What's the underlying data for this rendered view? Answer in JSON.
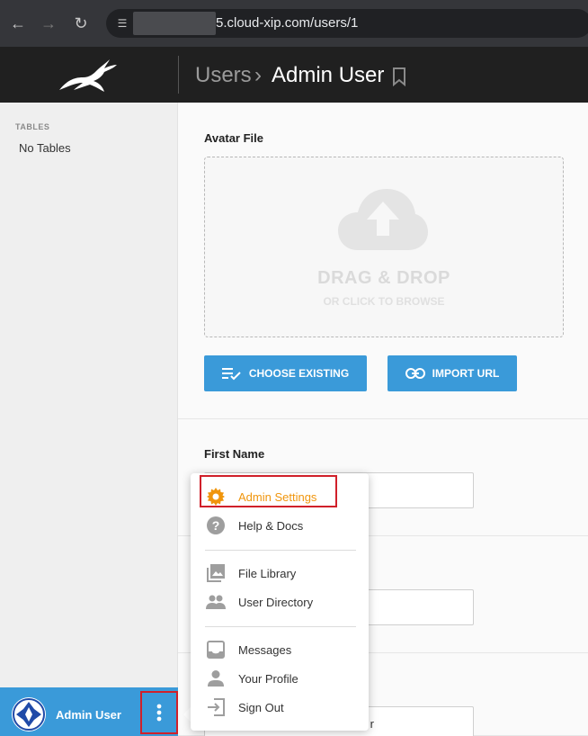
{
  "browser": {
    "back_icon": "back-arrow-icon",
    "forward_icon": "forward-arrow-icon",
    "reload_icon": "reload-icon",
    "url": "5.cloud-xip.com/users/1"
  },
  "header": {
    "breadcrumb_parent": "Users",
    "breadcrumb_separator": "›",
    "breadcrumb_current": "Admin User",
    "bookmark_icon": "bookmark-icon"
  },
  "sidebar": {
    "tables_heading": "TABLES",
    "no_tables": "No Tables"
  },
  "form": {
    "avatar_label": "Avatar File",
    "dropzone_main": "DRAG & DROP",
    "dropzone_sub": "OR CLICK TO BROWSE",
    "choose_existing": "CHOOSE EXISTING",
    "import_url": "IMPORT URL",
    "first_name_label": "First Name",
    "last_field_value_partial": "r"
  },
  "user_bar": {
    "name": "Admin User"
  },
  "menu": {
    "items": [
      {
        "label": "Admin Settings",
        "icon": "gear-icon",
        "active": true
      },
      {
        "label": "Help & Docs",
        "icon": "help-icon"
      },
      {
        "label": "File Library",
        "icon": "image-library-icon"
      },
      {
        "label": "User Directory",
        "icon": "users-icon"
      },
      {
        "label": "Messages",
        "icon": "inbox-icon"
      },
      {
        "label": "Your Profile",
        "icon": "person-icon"
      },
      {
        "label": "Sign Out",
        "icon": "sign-out-icon"
      }
    ]
  },
  "colors": {
    "accent_blue": "#3a9ad9",
    "active_orange": "#f0950c",
    "highlight_red": "#d0202a",
    "header_bg": "#202020"
  }
}
